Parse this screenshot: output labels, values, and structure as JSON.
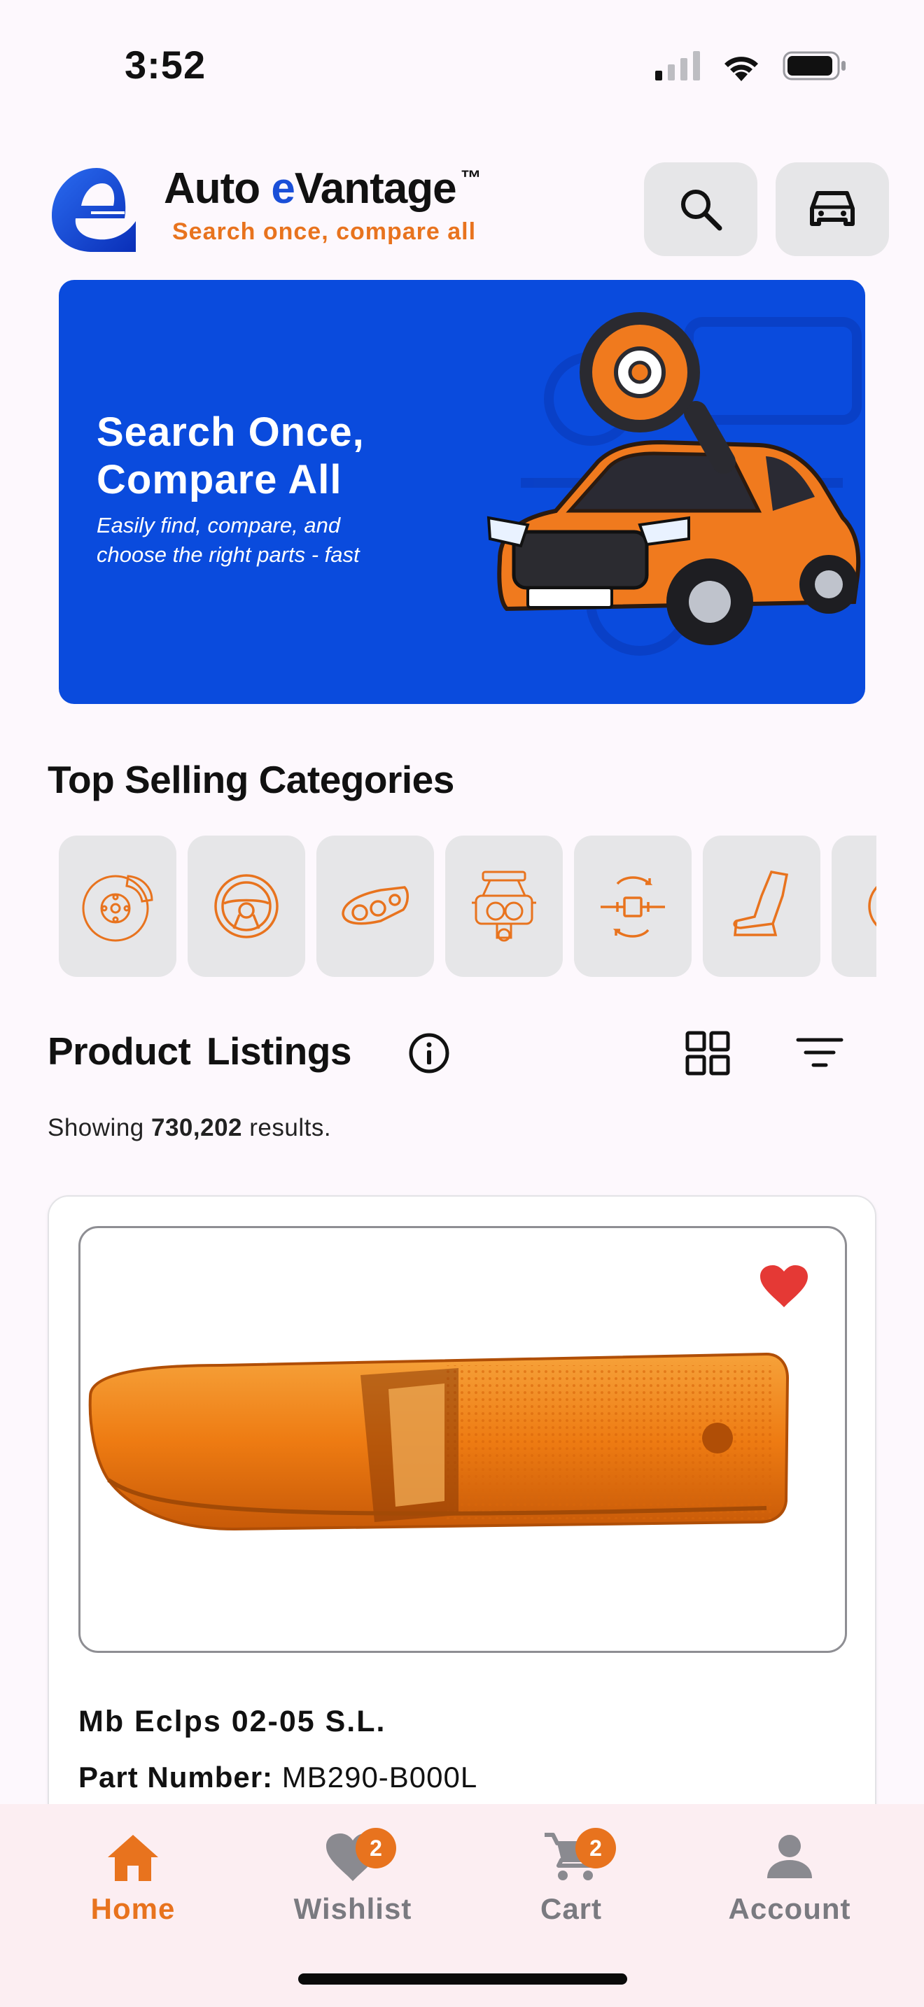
{
  "status_bar": {
    "time": "3:52"
  },
  "header": {
    "brand_prefix": "Auto ",
    "brand_e": "e",
    "brand_suffix": "Vantage",
    "brand_tm": "™",
    "tagline": "Search once, compare all",
    "search_icon": "search-icon",
    "vehicle_icon": "car-icon"
  },
  "banner": {
    "title_line1": "Search Once,",
    "title_line2": "Compare All",
    "subtitle_line1": "Easily find, compare, and",
    "subtitle_line2": "choose the right parts - fast"
  },
  "categories": {
    "title": "Top Selling Categories",
    "icons": [
      "brake-disc-icon",
      "steering-wheel-icon",
      "headlight-icon",
      "engine-icon",
      "fuel-filter-icon",
      "car-seat-icon",
      "partial-category-icon"
    ]
  },
  "listings": {
    "title": "Product Listings",
    "results_prefix": "Showing ",
    "results_count": "730,202",
    "results_suffix": " results."
  },
  "product": {
    "name": "Mb Eclps 02-05 S.L.",
    "part_label": "Part Number:",
    "part_number": "MB290-B000L",
    "favorited": true
  },
  "nav": {
    "items": [
      {
        "label": "Home",
        "icon": "home-icon",
        "active": true
      },
      {
        "label": "Wishlist",
        "icon": "heart-icon",
        "badge": "2"
      },
      {
        "label": "Cart",
        "icon": "cart-icon",
        "badge": "2"
      },
      {
        "label": "Account",
        "icon": "account-icon"
      }
    ]
  },
  "colors": {
    "accent": "#E8731E",
    "brand_blue": "#0A4BDD",
    "favorite": "#E53935"
  }
}
